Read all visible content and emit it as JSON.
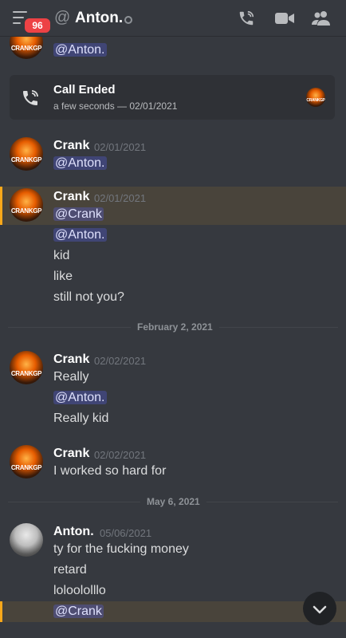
{
  "header": {
    "badge": "96",
    "at": "@",
    "title": "Anton.",
    "icons": [
      "menu-icon",
      "phone-icon",
      "video-icon",
      "members-icon"
    ]
  },
  "top_partial": {
    "mention": "@Anton.",
    "author": "CRANKGP"
  },
  "call": {
    "title": "Call Ended",
    "subtitle": "a few seconds — 02/01/2021"
  },
  "groups": [
    {
      "author": "Crank",
      "time": "02/01/2021",
      "lines": [
        "@Anton."
      ]
    },
    {
      "author": "Crank",
      "time": "02/01/2021",
      "lines": [
        "@Crank",
        "@Anton.",
        "kid",
        "like",
        "still not you?"
      ]
    },
    {
      "author": "Crank",
      "time": "02/02/2021",
      "lines": [
        "Really",
        "@Anton.",
        "Really kid"
      ]
    },
    {
      "author": "Crank",
      "time": "02/02/2021",
      "lines": [
        "I worked so hard for"
      ]
    },
    {
      "author": "Anton.",
      "time": "05/06/2021",
      "lines": [
        "ty for the fucking money",
        "retard",
        "loloololllo",
        "@Crank"
      ]
    }
  ],
  "dividers": [
    "February 2, 2021",
    "May 6, 2021"
  ],
  "avatar_label": "CRANKGP",
  "colors": {
    "background": "#36393f",
    "mention_bg": "#4a4f7a",
    "highlight_bar": "#faa81a",
    "badge": "#ed4245"
  }
}
